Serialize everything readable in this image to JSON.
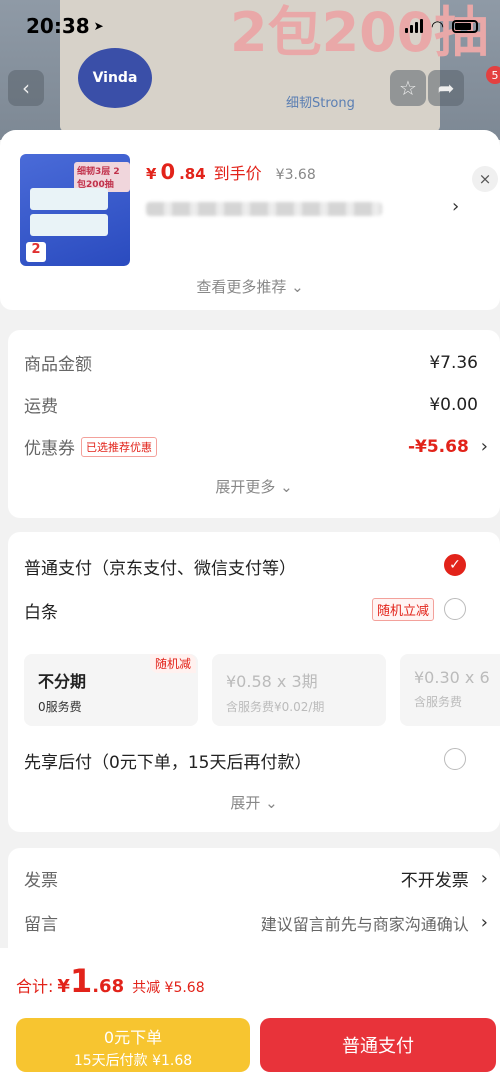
{
  "status_bar": {
    "time": "20:38"
  },
  "background": {
    "banner_text": "2包200抽",
    "brand": "Vinda",
    "sub_text": "细韧Strong",
    "cart_badge": "5"
  },
  "product": {
    "thumb_tag": "细韧3层 2包200抽",
    "thumb_num": "2",
    "price_symbol": "¥",
    "price_int": "0",
    "price_dec": ".84",
    "price_note": "到手价",
    "orig_price": "¥3.68",
    "close": "×",
    "more_rec": "查看更多推荐 ⌄"
  },
  "summary": {
    "rows": [
      {
        "label": "商品金额",
        "value": "¥7.36"
      },
      {
        "label": "运费",
        "value": "¥0.00"
      }
    ],
    "coupon": {
      "label": "优惠券",
      "tag": "已选推荐优惠",
      "value": "-¥5.68"
    },
    "expand": "展开更多 ⌄"
  },
  "payment": {
    "normal": "普通支付（京东支付、微信支付等）",
    "baitiao": "白条",
    "random_tag": "随机立减",
    "plans": [
      {
        "title": "不分期",
        "fee": "0服务费",
        "tag": "随机减"
      },
      {
        "title": "¥0.58 x 3期",
        "fee": "含服务费¥0.02/期"
      },
      {
        "title": "¥0.30 x 6",
        "fee": "含服务费"
      }
    ],
    "bnpl": "先享后付（0元下单，15天后再付款）",
    "expand": "展开 ⌄"
  },
  "invoice": {
    "label": "发票",
    "value": "不开发票"
  },
  "message": {
    "label": "留言",
    "value": "建议留言前先与商家沟通确认"
  },
  "bottom": {
    "total_label": "合计:",
    "symbol": "¥",
    "total_int": "1",
    "total_dec": ".68",
    "discount": "共减 ¥5.68",
    "yellow_t1": "0元下单",
    "yellow_t2": "15天后付款 ¥1.68",
    "red_btn": "普通支付"
  },
  "colors": {
    "accent": "#e2231a",
    "yellow": "#f7c530"
  }
}
